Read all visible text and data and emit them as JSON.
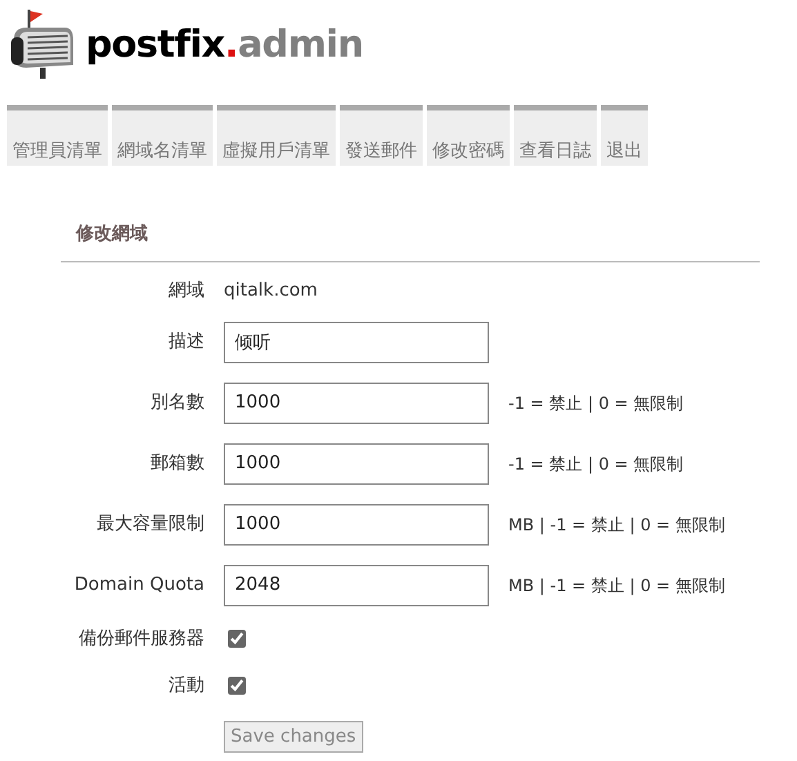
{
  "logo": {
    "name": "postfix",
    "dot": ".",
    "suffix": "admin"
  },
  "nav": [
    {
      "label": "管理員清單"
    },
    {
      "label": "網域名清單"
    },
    {
      "label": "虛擬用戶清單"
    },
    {
      "label": "發送郵件"
    },
    {
      "label": "修改密碼"
    },
    {
      "label": "查看日誌"
    },
    {
      "label": "退出"
    }
  ],
  "form": {
    "title": "修改網域",
    "fields": [
      {
        "kind": "static",
        "label": "網域",
        "value": "qitalk.com"
      },
      {
        "kind": "input",
        "label": "描述",
        "value": "倾听"
      },
      {
        "kind": "input",
        "label": "別名數",
        "value": "1000",
        "hint": "-1 = 禁止 | 0 = 無限制"
      },
      {
        "kind": "input",
        "label": "郵箱數",
        "value": "1000",
        "hint": "-1 = 禁止 | 0 = 無限制"
      },
      {
        "kind": "input",
        "label": "最大容量限制",
        "value": "1000",
        "hint": "MB | -1 = 禁止 | 0 = 無限制"
      },
      {
        "kind": "input",
        "label": "Domain Quota",
        "value": "2048",
        "hint": "MB | -1 = 禁止 | 0 = 無限制"
      },
      {
        "kind": "checkbox",
        "label": "備份郵件服務器",
        "checked": true
      },
      {
        "kind": "checkbox",
        "label": "活動",
        "checked": true
      }
    ],
    "button": "Save changes"
  }
}
